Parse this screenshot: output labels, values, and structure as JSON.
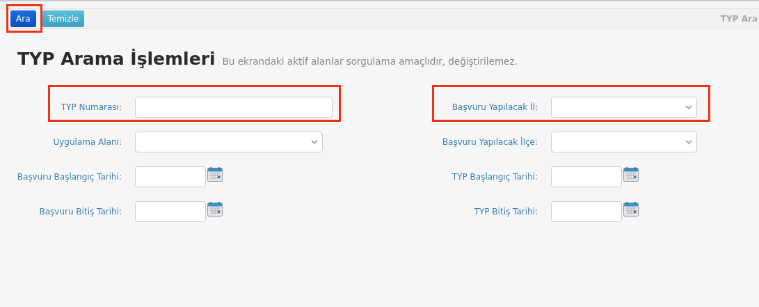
{
  "toolbar": {
    "buttons": [
      {
        "label": "Ara",
        "kind": "primary",
        "highlighted": true
      },
      {
        "label": "Temizle",
        "kind": "info",
        "highlighted": false
      }
    ],
    "page_title": "TYP Ara"
  },
  "heading": {
    "title": "TYP Arama İşlemleri",
    "subtitle": "Bu ekrandaki aktif alanlar sorgulama amaçlıdır, değiştirilemez."
  },
  "columns": [
    {
      "fields": [
        {
          "label": "TYP Numarası:",
          "kind": "text",
          "highlighted": true
        },
        {
          "label": "Uygulama Alanı:",
          "kind": "select",
          "highlighted": false
        },
        {
          "label": "Başvuru Başlangıç Tarihi:",
          "kind": "date",
          "highlighted": false
        },
        {
          "label": "Başvuru Bitiş Tarihi:",
          "kind": "date",
          "highlighted": false
        }
      ]
    },
    {
      "fields": [
        {
          "label": "Başvuru Yapılacak İl:",
          "kind": "select",
          "highlighted": true
        },
        {
          "label": "Başvuru Yapılacak İlçe:",
          "kind": "select",
          "highlighted": false
        },
        {
          "label": "TYP Başlangıç Tarihi:",
          "kind": "date",
          "highlighted": false
        },
        {
          "label": "TYP Bitiş Tarihi:",
          "kind": "date",
          "highlighted": false
        }
      ]
    }
  ]
}
